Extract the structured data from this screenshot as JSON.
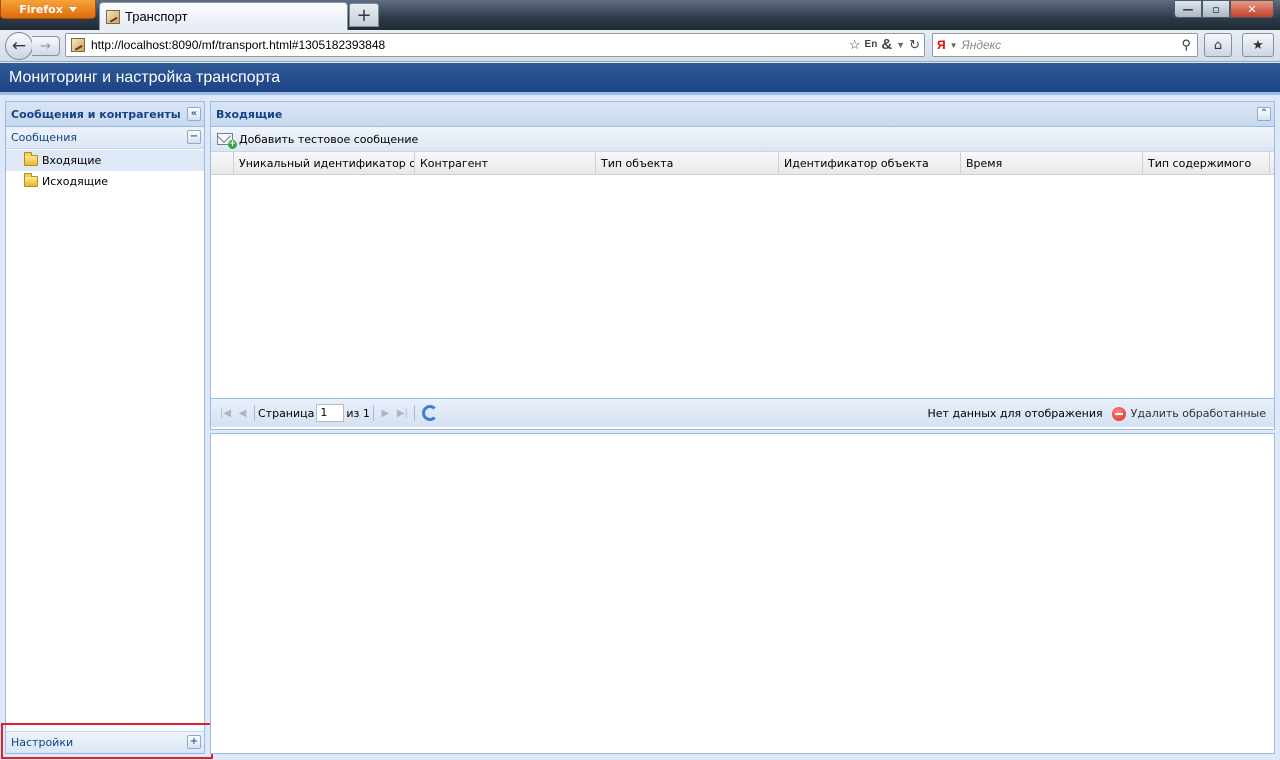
{
  "browser": {
    "menu_button": "Firefox",
    "tab_title": "Транспорт",
    "new_tab_symbol": "+",
    "url": "http://localhost:8090/mf/transport.html#1305182393848",
    "search_engine_badge": "Я",
    "search_placeholder": "Яндекс",
    "translate_badge": "En",
    "window_controls": {
      "minimize": "—",
      "maximize": "▫",
      "close": "✕"
    }
  },
  "app": {
    "title": "Мониторинг и настройка транспорта"
  },
  "west": {
    "title": "Сообщения и контрагенты",
    "messages_section": {
      "title": "Сообщения",
      "items": [
        {
          "label": "Входящие",
          "selected": true
        },
        {
          "label": "Исходящие",
          "selected": false
        }
      ]
    },
    "settings_section": {
      "title": "Настройки"
    }
  },
  "center": {
    "title": "Входящие",
    "toolbar": {
      "add_test_message": "Добавить тестовое сообщение"
    },
    "columns": [
      "Уникальный идентификатор сообщения",
      "Контрагент",
      "Тип объекта",
      "Идентификатор объекта",
      "Время",
      "Тип содержимого"
    ],
    "pager": {
      "page_label": "Страница",
      "page_value": "1",
      "of_label": "из 1",
      "empty_text": "Нет данных для отображения",
      "delete_processed": "Удалить обработанные"
    }
  },
  "colors": {
    "header_blue": "#1d4384",
    "panel_title": "#15428b",
    "panel_border": "#99bbe8",
    "highlight_red": "#e0202a"
  }
}
